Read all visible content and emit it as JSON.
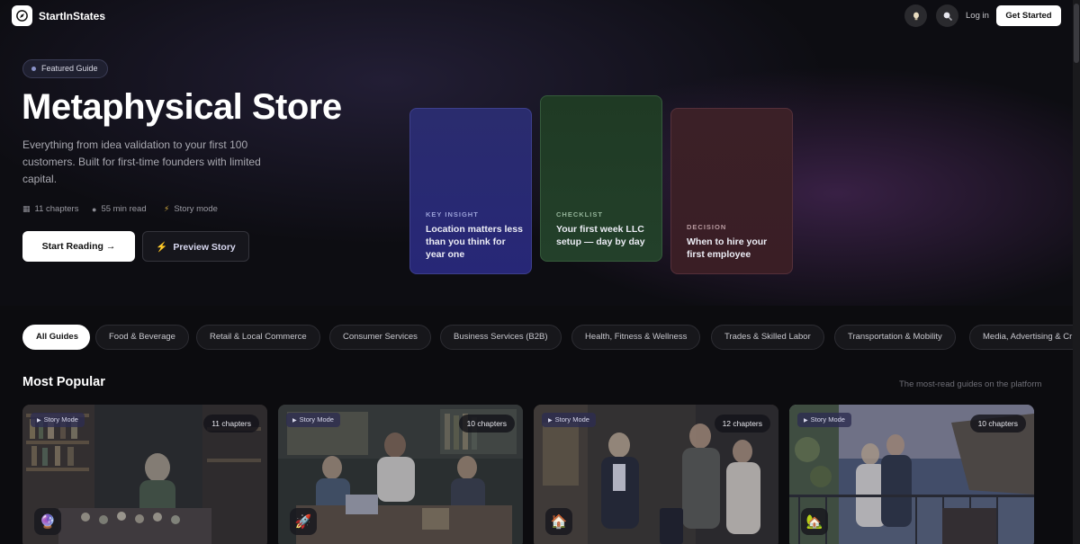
{
  "nav": {
    "brand": "StartInStates",
    "login": "Log in",
    "get_started": "Get Started"
  },
  "hero": {
    "badge": "Featured Guide",
    "title": "Metaphysical Store",
    "description": "Everything from idea validation to your first 100 customers. Built for first-time founders with limited capital.",
    "meta": {
      "chapters": "11 chapters",
      "read_time": "55 min read",
      "mode": "Story mode"
    },
    "primary_button": "Start Reading →",
    "secondary_button": "Preview Story"
  },
  "story_cards": [
    {
      "kicker": "KEY INSIGHT",
      "text": "Location matters less than you think for year one",
      "kicker_color": "#9aa0d8"
    },
    {
      "kicker": "CHECKLIST",
      "text": "Your first week LLC setup — day by day",
      "kicker_color": "#93b398"
    },
    {
      "kicker": "DECISION",
      "text": "When to hire your first employee",
      "kicker_color": "#b89aa0"
    }
  ],
  "filters": [
    "All Guides",
    "Food & Beverage",
    "Retail & Local Commerce",
    "Consumer Services",
    "Business Services (B2B)",
    "Health, Fitness & Wellness",
    "Trades & Skilled Labor",
    "Transportation & Mobility",
    "Media, Advertising & Cr"
  ],
  "section": {
    "title": "Most Popular",
    "subtitle": "The most-read guides on the platform"
  },
  "guides": [
    {
      "story_label": "Story Mode",
      "chapters": "11 chapters",
      "emoji": "🔮"
    },
    {
      "story_label": "Story Mode",
      "chapters": "10 chapters",
      "emoji": "🚀"
    },
    {
      "story_label": "Story Mode",
      "chapters": "12 chapters",
      "emoji": "🏠"
    },
    {
      "story_label": "Story Mode",
      "chapters": "10 chapters",
      "emoji": "🏡"
    }
  ]
}
